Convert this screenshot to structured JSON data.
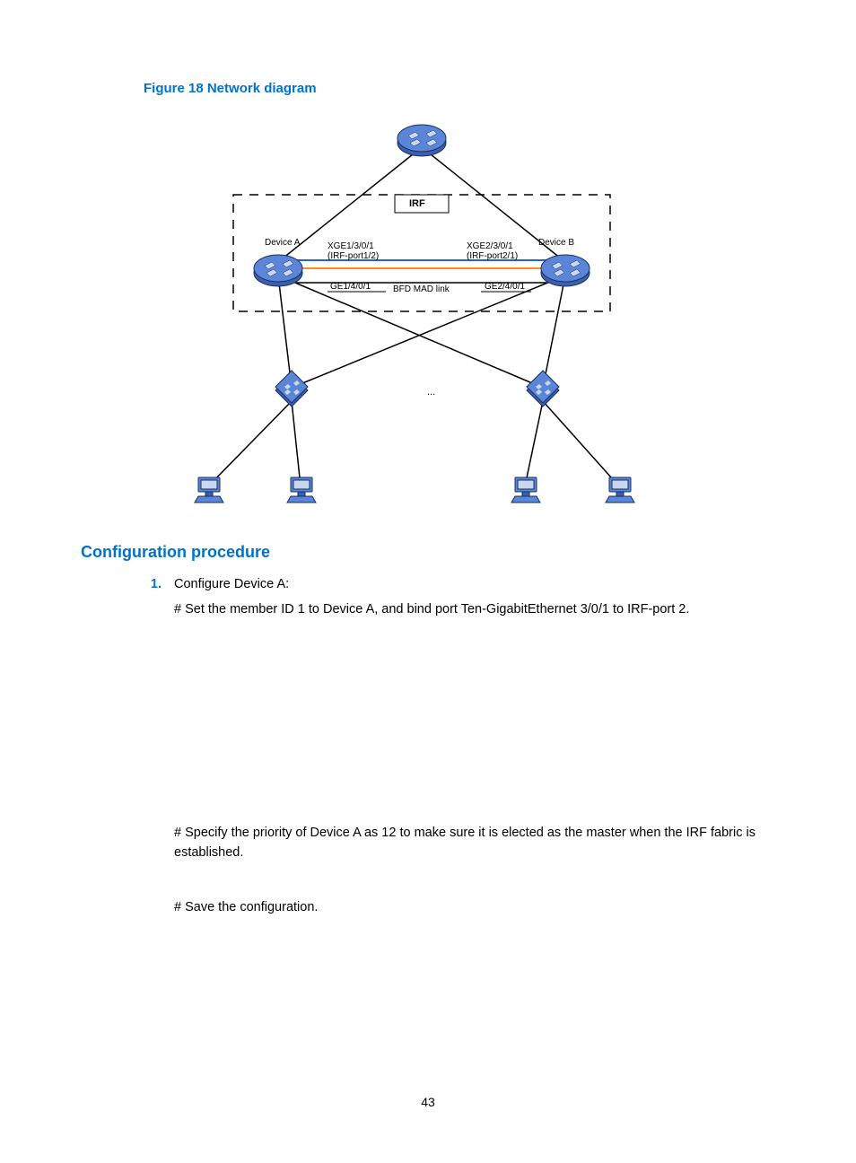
{
  "figure_title": "Figure 18 Network diagram",
  "section_heading": "Configuration procedure",
  "step_num": "1.",
  "step_title": "Configure Device A:",
  "step_line1": "# Set the member ID 1 to Device A, and bind port Ten-GigabitEthernet 3/0/1 to IRF-port 2.",
  "step_line2": "# Specify the priority of Device A as 12 to make sure it is elected as the master when the IRF fabric is established.",
  "step_line3": "# Save the configuration.",
  "page_number": "43",
  "diagram": {
    "irf_label": "IRF",
    "device_a": "Device A",
    "device_b": "Device B",
    "xge1": "XGE1/3/0/1",
    "irfport1": "(IRF-port1/2)",
    "xge2": "XGE2/3/0/1",
    "irfport2": "(IRF-port2/1)",
    "ge1": "GE1/4/0/1",
    "ge2": "GE2/4/0/1",
    "bfd": "BFD MAD link",
    "dots": "..."
  }
}
